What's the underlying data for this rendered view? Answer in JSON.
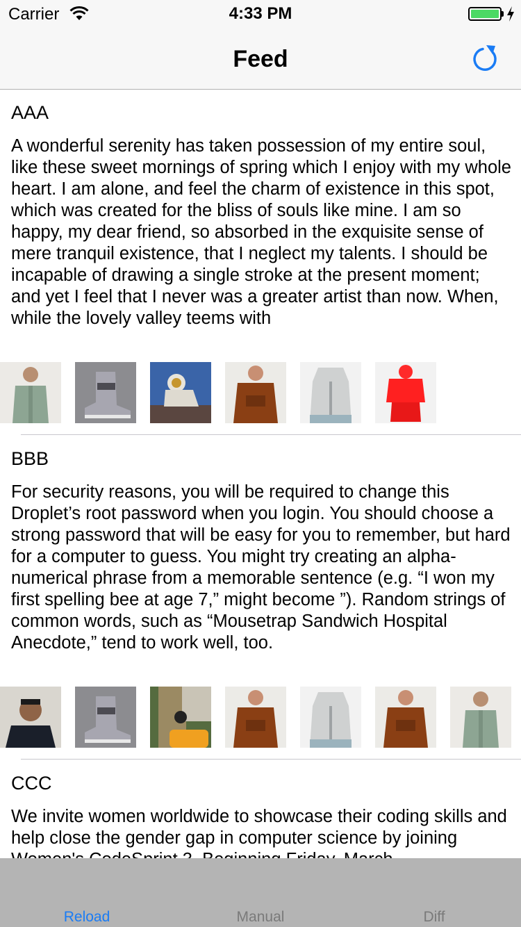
{
  "status": {
    "carrier": "Carrier",
    "time": "4:33 PM",
    "icons": [
      "wifi-icon",
      "battery-icon",
      "charging-bolt-icon"
    ],
    "battery_color": "#4cd964"
  },
  "nav": {
    "title": "Feed",
    "right_icon": "refresh-icon",
    "accent": "#1a7cf5"
  },
  "posts": [
    {
      "title": "AAA",
      "body": "A wonderful serenity has taken possession of my entire soul, like these sweet mornings of spring which I enjoy with my whole heart. I am alone, and feel the charm of existence in this spot, which was created for the bliss of souls like mine. I am so happy, my dear friend, so absorbed in the exquisite sense of mere tranquil existence, that I neglect my talents. I should be incapable of drawing a single stroke at the present moment; and yet I feel that I never was a greater artist than now. When, while the lovely valley teems with",
      "images": [
        "green-jacket-photo",
        "grey-sneaker-photo",
        "astronaut-photo",
        "brown-jacket-photo",
        "grey-hoodie-photo",
        "red-tracksuit-photo"
      ]
    },
    {
      "title": "BBB",
      "body": "For security reasons, you will be required to change this Droplet’s root password when you login. You should choose a strong password that will be easy for you to remember, but hard for a computer to guess. You might try creating an alpha-numerical phrase from a memorable sentence (e.g. “I won my first spelling bee at age 7,” might become ”). Random strings of common words, such as “Mousetrap Sandwich Hospital Anecdote,” tend to work well, too.",
      "images": [
        "man-portrait-photo",
        "grey-sneaker-photo",
        "watch-wrist-photo",
        "brown-jacket-photo",
        "grey-hoodie-photo",
        "brown-jacket-photo",
        "green-jacket-photo"
      ]
    },
    {
      "title": "CCC",
      "body": "We invite women worldwide to showcase their coding skills and help close the gender gap in computer science by joining Women's CodeSprint 3. Beginning Friday, March",
      "images": []
    }
  ],
  "tabs": [
    {
      "label": "Reload",
      "active": true,
      "color": "#1a7cf5"
    },
    {
      "label": "Manual",
      "active": false,
      "color": "#7a7a7a"
    },
    {
      "label": "Diff",
      "active": false,
      "color": "#7a7a7a"
    }
  ]
}
